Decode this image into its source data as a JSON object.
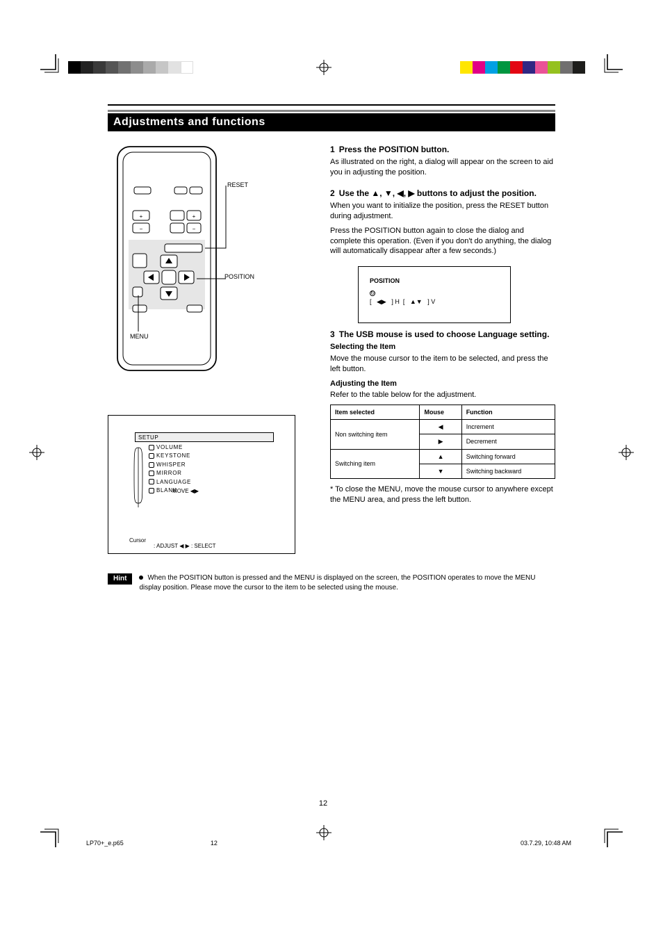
{
  "title": "Adjustments and functions",
  "remote_labels": {
    "reset": "RESET",
    "position": "POSITION",
    "menu": "MENU"
  },
  "menu_osd": {
    "header": "SETUP",
    "items": [
      "VOLUME",
      "KEYSTONE",
      "WHISPER",
      "MIRROR",
      "LANGUAGE",
      "BLANK"
    ],
    "caption_cursor": "Cursor",
    "move_hint": "MOVE ◀▶",
    "adjust_hint": ": ADJUST ◀ ▶  : SELECT"
  },
  "position_osd": {
    "title": "POSITION",
    "icon_hint": "⟳",
    "line1": "[     ] H  [     ] V",
    "lhint": "◀▶",
    "rhint": "▲▼"
  },
  "steps": {
    "s1": {
      "num": "1",
      "title": "Press the POSITION button.",
      "body": "As illustrated on the right, a dialog will appear on the screen to aid you in adjusting the position."
    },
    "s2": {
      "num": "2",
      "title": "Use the ▲, ▼, ◀, ▶ buttons to adjust the position.",
      "body1": "When you want to initialize the position, press the RESET button during adjustment.",
      "body2": "Press the POSITION button again to close the dialog and complete this operation. (Even if you don't do anything, the dialog will automatically disappear after a few seconds.)"
    },
    "s3": {
      "num": "3",
      "title": "The USB mouse is used to choose Language setting.",
      "sub1_h": "Selecting the Item",
      "sub1_b": "Move the mouse cursor to the item to be selected, and press the left button.",
      "sub2_h": "Adjusting the Item",
      "sub2_b": "Refer to the table below for the adjustment.",
      "close": "* To close the MENU, move the mouse cursor to anywhere except the MENU area, and press the left button."
    }
  },
  "adjust_table": {
    "h1": "Item selected",
    "h2": "Mouse",
    "h3": "Function",
    "rows": [
      {
        "item": "Non switching item",
        "mouse": "◀",
        "fn": "Increment"
      },
      {
        "item": "",
        "mouse": "▶",
        "fn": "Decrement"
      },
      {
        "item": "Switching item",
        "mouse": "▲",
        "fn": "Switching forward"
      },
      {
        "item": "",
        "mouse": "▼",
        "fn": "Switching backward"
      }
    ]
  },
  "hint": {
    "tag": "Hint",
    "bullet": "When the POSITION button is pressed and the MENU is displayed on the screen, the POSITION operates to move the MENU display position. Please move the cursor to the item to be selected using the mouse."
  },
  "page_number": "12",
  "footer_file": "LP70+_e.p65",
  "footer_date": "03.7.29, 10:48 AM",
  "footer_page": "12"
}
